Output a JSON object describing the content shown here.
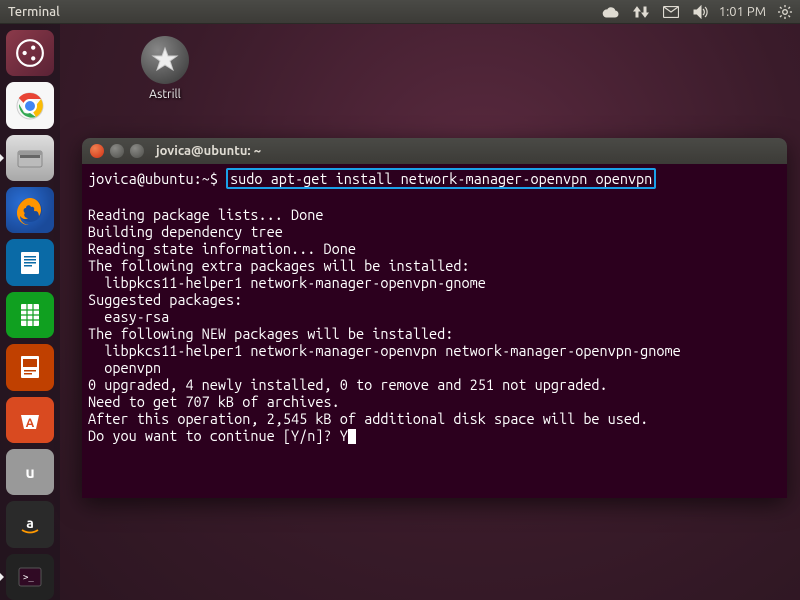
{
  "menubar": {
    "app_title": "Terminal",
    "time": "1:01 PM"
  },
  "launcher": {
    "items": [
      {
        "name": "dash",
        "icon": "ubuntu-dash"
      },
      {
        "name": "chrome",
        "icon": "chrome"
      },
      {
        "name": "files",
        "icon": "files"
      },
      {
        "name": "firefox",
        "icon": "firefox"
      },
      {
        "name": "writer",
        "icon": "document"
      },
      {
        "name": "calc",
        "icon": "spreadsheet"
      },
      {
        "name": "impress",
        "icon": "presentation"
      },
      {
        "name": "software-center",
        "icon": "bag-A"
      },
      {
        "name": "ubuntu-one",
        "icon": "u1"
      },
      {
        "name": "amazon",
        "icon": "amazon"
      },
      {
        "name": "terminal",
        "icon": "terminal"
      }
    ]
  },
  "desktop": {
    "astrill_label": "Astrill"
  },
  "terminal": {
    "title": "jovica@ubuntu: ~",
    "prompt_user_host": "jovica@ubuntu",
    "prompt_path": "~",
    "prompt_suffix": "$",
    "command": "sudo apt-get install network-manager-openvpn openvpn",
    "output_lines": [
      "Reading package lists... Done",
      "Building dependency tree",
      "Reading state information... Done",
      "The following extra packages will be installed:",
      "  libpkcs11-helper1 network-manager-openvpn-gnome",
      "Suggested packages:",
      "  easy-rsa",
      "The following NEW packages will be installed:",
      "  libpkcs11-helper1 network-manager-openvpn network-manager-openvpn-gnome",
      "  openvpn",
      "0 upgraded, 4 newly installed, 0 to remove and 251 not upgraded.",
      "Need to get 707 kB of archives.",
      "After this operation, 2,545 kB of additional disk space will be used."
    ],
    "continue_prompt": "Do you want to continue [Y/n]? ",
    "user_input": "Y"
  }
}
